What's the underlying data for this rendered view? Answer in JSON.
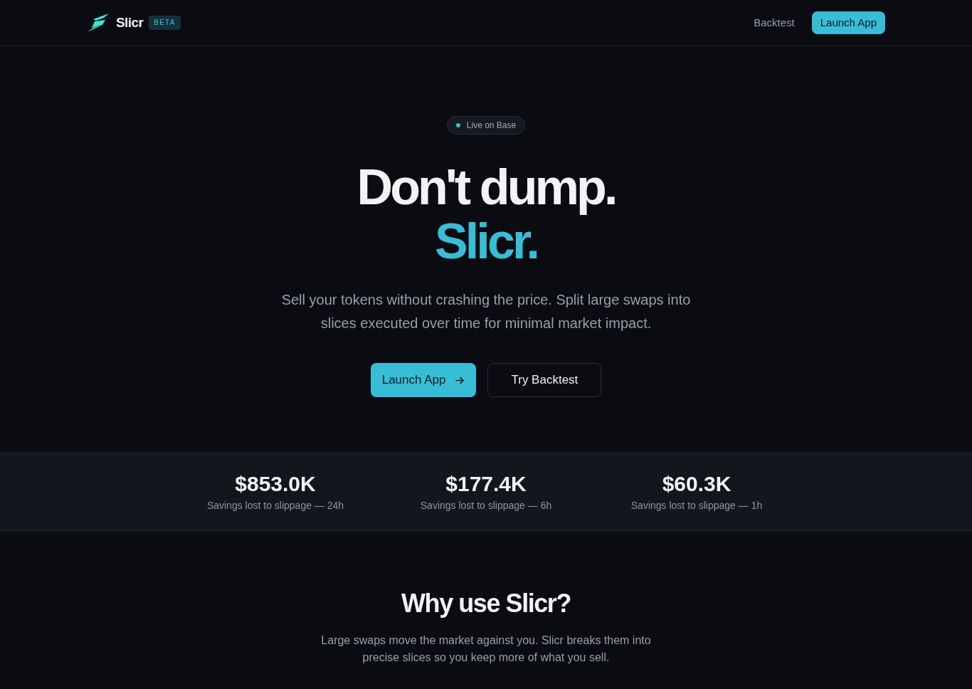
{
  "header": {
    "logo": {
      "name": "Slicr",
      "badge": "BETA"
    },
    "nav": [
      {
        "label": "Backtest",
        "kind": "link"
      },
      {
        "label": "Launch App",
        "kind": "button"
      }
    ]
  },
  "hero": {
    "status_badge": "Live on Base",
    "headline": "Don't dump.",
    "headline_accent": "Slicr.",
    "subtitle": "Sell your tokens without crashing the price. Split large swaps into slices executed over time for minimal market impact.",
    "buttons": [
      {
        "label": "Launch App",
        "kind": "primary"
      },
      {
        "label": "Try Backtest",
        "kind": "secondary"
      }
    ]
  },
  "stats": [
    {
      "value": "$853.0K",
      "label": "Savings lost to slippage — 24h"
    },
    {
      "value": "$177.4K",
      "label": "Savings lost to slippage — 6h"
    },
    {
      "value": "$60.3K",
      "label": "Savings lost to slippage — 1h"
    }
  ],
  "why": {
    "title": "Why use Slicr?",
    "text": "Large swaps move the market against you. Slicr breaks them into precise slices so you keep more of what you sell."
  }
}
